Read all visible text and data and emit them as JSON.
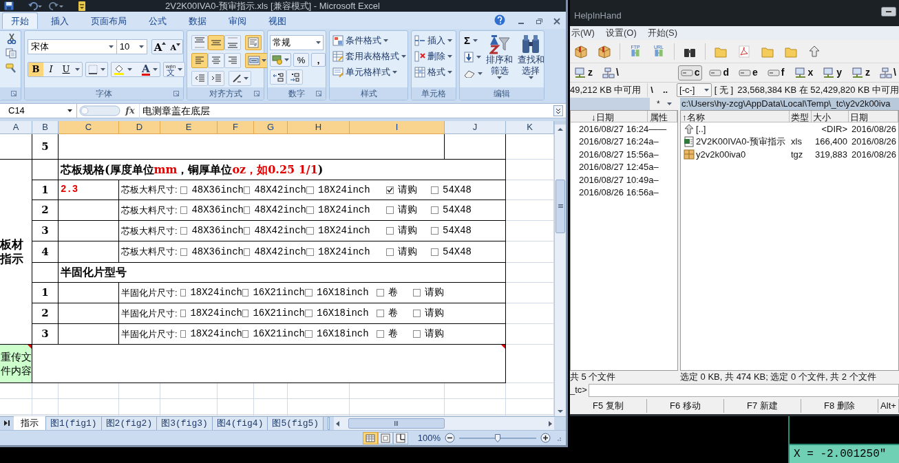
{
  "excel": {
    "title": "2V2K00IVA0-预审指示.xls  [兼容模式] - Microsoft Excel",
    "tabs": [
      {
        "label": "开始",
        "selected": true
      },
      {
        "label": "插入",
        "selected": false
      },
      {
        "label": "页面布局",
        "selected": false
      },
      {
        "label": "公式",
        "selected": false
      },
      {
        "label": "数据",
        "selected": false
      },
      {
        "label": "审阅",
        "selected": false
      },
      {
        "label": "视图",
        "selected": false
      }
    ],
    "font_group": {
      "label": "字体",
      "font": "宋体",
      "size": "10",
      "grow": "A",
      "shrink": "A",
      "styles": [
        {
          "label": "B",
          "selected": true
        },
        {
          "label": "I",
          "selected": false
        },
        {
          "label": "U",
          "selected": false
        }
      ],
      "color_letter": "A",
      "phonetic_top": "wén",
      "phonetic": "文"
    },
    "alignment_group": {
      "label": "对齐方式",
      "buttons": [
        {
          "kind": "top",
          "selected": false
        },
        {
          "kind": "middle",
          "selected": true
        },
        {
          "kind": "bottom",
          "selected": false
        },
        {
          "kind": "wrap",
          "selected": true
        },
        {
          "kind": "left",
          "selected": true
        },
        {
          "kind": "center",
          "selected": false
        },
        {
          "kind": "right",
          "selected": false
        },
        {
          "kind": "merge",
          "selected": true
        },
        {
          "kind": "outdent",
          "selected": false
        },
        {
          "kind": "indent",
          "selected": false
        },
        {
          "kind": "orientation",
          "selected": false
        }
      ]
    },
    "number_group": {
      "label": "数字",
      "format": "常规",
      "percent": "%",
      "comma": ","
    },
    "styles_group": {
      "label": "样式",
      "items": [
        "条件格式",
        "套用表格格式",
        "单元格样式"
      ]
    },
    "cells_group": {
      "label": "单元格",
      "items": [
        "插入",
        "删除",
        "格式"
      ]
    },
    "editing_group": {
      "label": "编辑",
      "sum": "Σ",
      "sort": "排序和筛选",
      "find": "查找和选择"
    },
    "name_box": "C14",
    "function_label": "fx",
    "formula": "电测章盖在底层",
    "columns": [
      {
        "label": "A",
        "selected": false
      },
      {
        "label": "B",
        "selected": false
      },
      {
        "label": "C",
        "selected": true
      },
      {
        "label": "D",
        "selected": true
      },
      {
        "label": "E",
        "selected": true
      },
      {
        "label": "F",
        "selected": true
      },
      {
        "label": "G",
        "selected": true
      },
      {
        "label": "H",
        "selected": true
      },
      {
        "label": "I",
        "selected": true
      },
      {
        "label": "J",
        "selected": false
      },
      {
        "label": "K",
        "selected": false
      }
    ],
    "sheet": {
      "top_row_number": "5",
      "group_label": "板材指示",
      "core_title": [
        {
          "text": "芯板规格(厚度单位",
          "red": false
        },
        {
          "text": "mm",
          "red": true
        },
        {
          "text": "，铜厚单位",
          "red": false
        },
        {
          "text": "oz，如0.25 1/1",
          "red": true
        },
        {
          "text": ")",
          "red": false
        }
      ],
      "core_rows": [
        {
          "number": "1",
          "note": "2.3",
          "label": "芯板大料尺寸:",
          "options": [
            {
              "text": "48X36inch",
              "checked": false
            },
            {
              "text": "48X42inch",
              "checked": false
            },
            {
              "text": "18X24inch",
              "checked": false
            },
            {
              "text": "请购",
              "checked": true
            },
            {
              "text": "54X48",
              "checked": false
            }
          ]
        },
        {
          "number": "2",
          "label": "芯板大料尺寸:",
          "options": [
            {
              "text": "48X36inch",
              "checked": false
            },
            {
              "text": "48X42inch",
              "checked": false
            },
            {
              "text": "18X24inch",
              "checked": false
            },
            {
              "text": "请购",
              "checked": false
            },
            {
              "text": "54X48",
              "checked": false
            }
          ]
        },
        {
          "number": "3",
          "label": "芯板大料尺寸:",
          "options": [
            {
              "text": "48X36inch",
              "checked": false
            },
            {
              "text": "48X42inch",
              "checked": false
            },
            {
              "text": "18X24inch",
              "checked": false
            },
            {
              "text": "请购",
              "checked": false
            },
            {
              "text": "54X48",
              "checked": false
            }
          ]
        },
        {
          "number": "4",
          "label": "芯板大料尺寸:",
          "options": [
            {
              "text": "48X36inch",
              "checked": false
            },
            {
              "text": "48X42inch",
              "checked": false
            },
            {
              "text": "18X24inch",
              "checked": false
            },
            {
              "text": "请购",
              "checked": false
            },
            {
              "text": "54X48",
              "checked": false
            }
          ]
        }
      ],
      "prepreg_title": "半固化片型号",
      "prepreg_rows": [
        {
          "number": "1",
          "label": "半固化片尺寸:",
          "options": [
            {
              "text": "18X24inch",
              "checked": false
            },
            {
              "text": "16X21inch",
              "checked": false
            },
            {
              "text": "16X18inch",
              "checked": false
            },
            {
              "text": "卷",
              "checked": false
            },
            {
              "text": "请购",
              "checked": false
            }
          ]
        },
        {
          "number": "2",
          "label": "半固化片尺寸:",
          "options": [
            {
              "text": "18X24inch",
              "checked": false
            },
            {
              "text": "16X21inch",
              "checked": false
            },
            {
              "text": "16X18inch",
              "checked": false
            },
            {
              "text": "卷",
              "checked": false
            },
            {
              "text": "请购",
              "checked": false
            }
          ]
        },
        {
          "number": "3",
          "label": "半固化片尺寸:",
          "options": [
            {
              "text": "18X24inch",
              "checked": false
            },
            {
              "text": "16X21inch",
              "checked": false
            },
            {
              "text": "16X18inch",
              "checked": false
            },
            {
              "text": "卷",
              "checked": false
            },
            {
              "text": "请购",
              "checked": false
            }
          ]
        }
      ],
      "note_label": "重传文件内容"
    },
    "sheet_tabs": [
      {
        "label": "指示",
        "selected": true
      },
      {
        "label": "图1(fig1)",
        "selected": false
      },
      {
        "label": "图2(fig2)",
        "selected": false
      },
      {
        "label": "图3(fig3)",
        "selected": false
      },
      {
        "label": "图4(fig4)",
        "selected": false
      },
      {
        "label": "图5(fig5)",
        "selected": false
      }
    ],
    "views": [
      {
        "kind": "normal",
        "selected": true
      },
      {
        "kind": "layout",
        "selected": false
      },
      {
        "kind": "break",
        "selected": false
      }
    ],
    "zoom": {
      "label": "100%",
      "level": 0.5
    }
  },
  "commander": {
    "title": "HelpInHand",
    "menu": [
      "示(W)",
      "设置(O)",
      "开始(S)"
    ],
    "toolbar": [
      {
        "kind": "package"
      },
      {
        "kind": "package"
      },
      {
        "kind": "transfer",
        "label": "FTP"
      },
      {
        "kind": "transfer",
        "label": "URL"
      },
      {
        "kind": "binoculars"
      },
      {
        "kind": "folder"
      },
      {
        "kind": "pdf"
      },
      {
        "kind": "folder"
      },
      {
        "kind": "folder"
      },
      {
        "kind": "up"
      }
    ],
    "left_drives": [
      {
        "letter": "z",
        "kind": "network",
        "selected": false
      },
      {
        "letter": "\\",
        "kind": "root",
        "selected": false
      }
    ],
    "right_drives": [
      {
        "letter": "c",
        "kind": "disk",
        "selected": true
      },
      {
        "letter": "d",
        "kind": "disk",
        "selected": false
      },
      {
        "letter": "e",
        "kind": "disk",
        "selected": false
      },
      {
        "letter": "f",
        "kind": "disk",
        "selected": false
      },
      {
        "letter": "x",
        "kind": "network",
        "selected": false
      },
      {
        "letter": "y",
        "kind": "network",
        "selected": false
      },
      {
        "letter": "z",
        "kind": "network",
        "selected": false
      },
      {
        "letter": "\\",
        "kind": "root",
        "selected": false
      }
    ],
    "left_free": "49,212 KB 中可用",
    "nav": [
      "\\",
      ".."
    ],
    "drive_select": "[-c-]",
    "volume": "[ 无 ]",
    "right_free": "23,568,384 KB 在 52,429,820 KB 中可用",
    "left_filter": "*",
    "right_path": "c:\\Users\\hy-zcg\\AppData\\Local\\Temp\\_tc\\y2v2k00iva",
    "left_columns": [
      "↓日期",
      "属性"
    ],
    "left_files": [
      {
        "date": "2016/08/27 16:24",
        "attr": "——"
      },
      {
        "date": "2016/08/27 16:24",
        "attr": "a–"
      },
      {
        "date": "2016/08/27 15:56",
        "attr": "a–"
      },
      {
        "date": "2016/08/27 12:45",
        "attr": "a–"
      },
      {
        "date": "2016/08/27 10:49",
        "attr": "a–"
      },
      {
        "date": "2016/08/26 16:56",
        "attr": "a–"
      }
    ],
    "right_columns": [
      "↑名称",
      "类型",
      "大小",
      "日期"
    ],
    "right_files": [
      {
        "kind": "parent",
        "name": "[..]",
        "size": "<DIR>",
        "date": "2016/08/26"
      },
      {
        "kind": "sheet",
        "name": "2V2K00IVA0-预审指示",
        "type": "xls",
        "size": "166,400",
        "date": "2016/08/26"
      },
      {
        "kind": "archive",
        "name": "y2v2k00iva0",
        "type": "tgz",
        "size": "319,883",
        "date": "2016/08/26"
      }
    ],
    "left_status": "共 5 个文件",
    "right_status": "选定 0 KB, 共 474 KB; 选定 0 个文件, 共 2 个文件",
    "prompt": "_tc>",
    "function_keys": [
      "F5 复制",
      "F6 移动",
      "F7 新建",
      "F8 删除",
      "Alt+"
    ]
  },
  "readout": "X = -2.001250\""
}
